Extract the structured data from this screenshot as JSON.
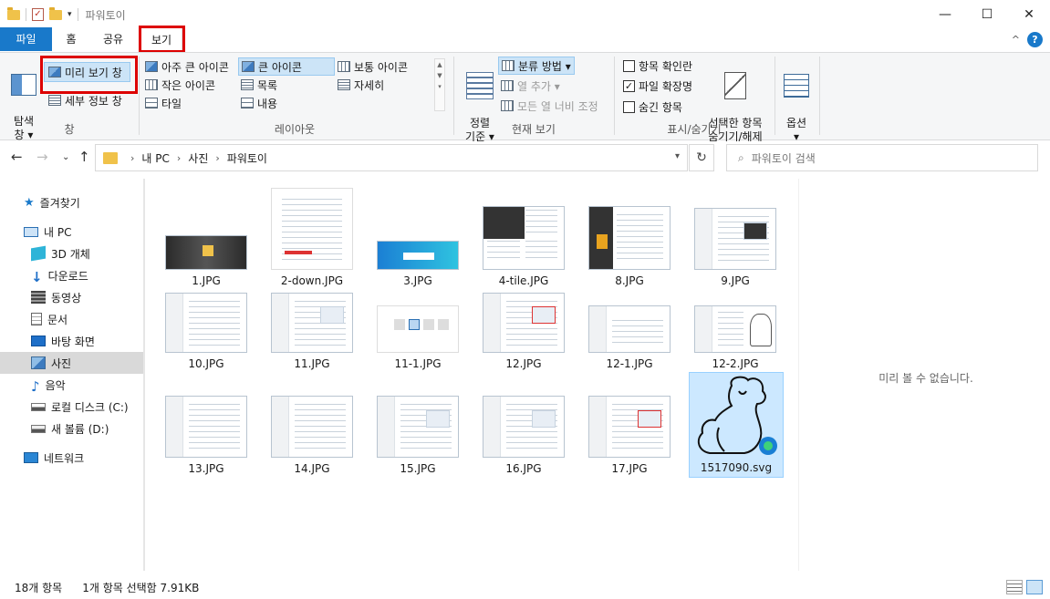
{
  "window": {
    "title": "파워토이",
    "controls": [
      "—",
      "☐",
      "✕"
    ]
  },
  "tabs": {
    "file": "파일",
    "home": "홈",
    "share": "공유",
    "view": "보기"
  },
  "ribbon": {
    "pane": {
      "nav_pane_label": "탐색\n창 ▾",
      "preview_pane": "미리 보기 창",
      "details_pane": "세부 정보 창",
      "group_label": "창"
    },
    "layout": {
      "items": [
        "아주 큰 아이콘",
        "큰 아이콘",
        "보통 아이콘",
        "작은 아이콘",
        "목록",
        "자세히",
        "타일",
        "내용"
      ],
      "selected": "큰 아이콘",
      "group_label": "레이아웃"
    },
    "current_view": {
      "sort_by": "정렬\n기준 ▾",
      "group_by": "분류 방법 ▾",
      "add_columns": "열 추가 ▾",
      "fit_columns": "모든 열 너비 조정",
      "group_label": "현재 보기"
    },
    "show_hide": {
      "item_checkboxes": "항목 확인란",
      "item_checkboxes_checked": false,
      "file_extensions": "파일 확장명",
      "file_extensions_checked": true,
      "hidden_items": "숨긴 항목",
      "hidden_items_checked": false,
      "hide_selected": "선택한 항목\n숨기기/해제",
      "group_label": "표시/숨기기"
    },
    "options": {
      "label": "옵션\n▾"
    }
  },
  "address": {
    "crumbs": [
      "내 PC",
      "사진",
      "파워토이"
    ],
    "search_placeholder": "파워토이 검색"
  },
  "nav": {
    "items": [
      {
        "label": "즐겨찾기",
        "icon": "star-icon"
      },
      {
        "label": "내 PC",
        "icon": "computer-icon"
      },
      {
        "label": "3D 개체",
        "icon": "cube-icon"
      },
      {
        "label": "다운로드",
        "icon": "download-icon"
      },
      {
        "label": "동영상",
        "icon": "film-icon"
      },
      {
        "label": "문서",
        "icon": "document-icon"
      },
      {
        "label": "바탕 화면",
        "icon": "desktop-icon"
      },
      {
        "label": "사진",
        "icon": "pictures-icon"
      },
      {
        "label": "음악",
        "icon": "music-icon"
      },
      {
        "label": "로컬 디스크 (C:)",
        "icon": "drive-icon"
      },
      {
        "label": "새 볼륨 (D:)",
        "icon": "drive-icon"
      },
      {
        "label": "네트워크",
        "icon": "network-icon"
      }
    ],
    "selected": "사진"
  },
  "files": [
    {
      "name": "1.JPG"
    },
    {
      "name": "2-down.JPG"
    },
    {
      "name": "3.JPG"
    },
    {
      "name": "4-tile.JPG"
    },
    {
      "name": "8.JPG"
    },
    {
      "name": "9.JPG"
    },
    {
      "name": "10.JPG"
    },
    {
      "name": "11.JPG"
    },
    {
      "name": "11-1.JPG"
    },
    {
      "name": "12.JPG"
    },
    {
      "name": "12-1.JPG"
    },
    {
      "name": "12-2.JPG"
    },
    {
      "name": "13.JPG"
    },
    {
      "name": "14.JPG"
    },
    {
      "name": "15.JPG"
    },
    {
      "name": "16.JPG"
    },
    {
      "name": "17.JPG"
    },
    {
      "name": "1517090.svg"
    }
  ],
  "preview_message": "미리 볼 수 없습니다.",
  "status": {
    "count": "18개 항목",
    "selection": "1개 항목 선택함 7.91KB"
  }
}
